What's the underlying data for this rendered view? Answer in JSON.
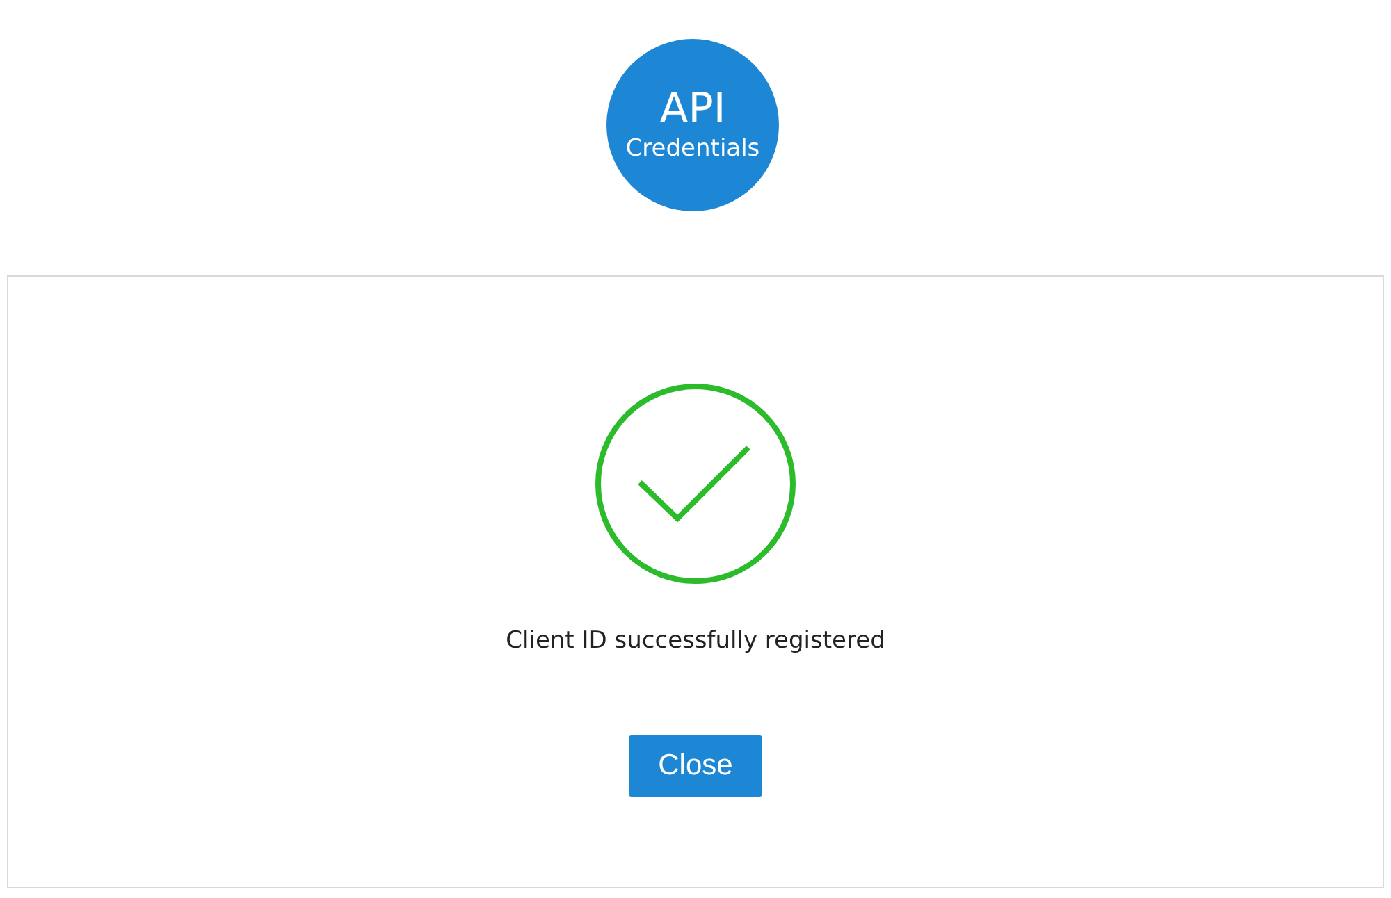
{
  "logo": {
    "title": "API",
    "subtitle": "Credentials"
  },
  "dialog": {
    "message": "Client ID successfully registered",
    "button": "Close"
  }
}
